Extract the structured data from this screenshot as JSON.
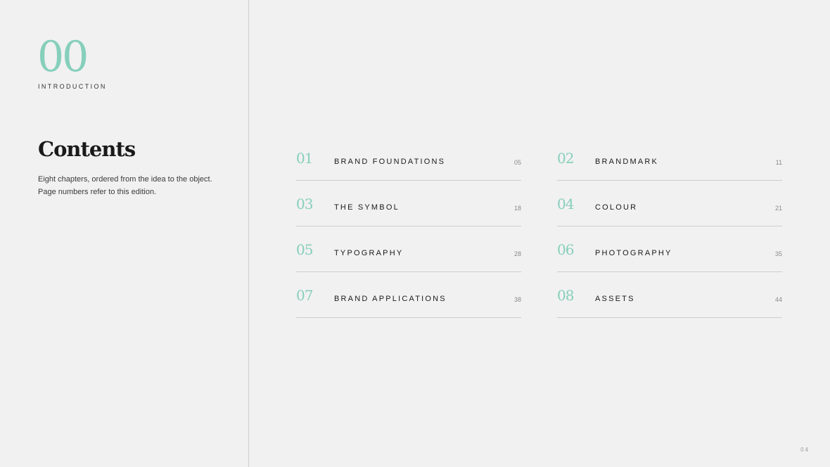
{
  "section": {
    "number": "00",
    "label": "INTRODUCTION"
  },
  "contents": {
    "title": "Contents",
    "description": "Eight chapters, ordered from the idea to the object. Page numbers refer to this edition."
  },
  "toc": [
    {
      "num": "01",
      "title": "BRAND FOUNDATIONS",
      "page": "05"
    },
    {
      "num": "02",
      "title": "BRANDMARK",
      "page": "11"
    },
    {
      "num": "03",
      "title": "THE SYMBOL",
      "page": "18"
    },
    {
      "num": "04",
      "title": "COLOUR",
      "page": "21"
    },
    {
      "num": "05",
      "title": "TYPOGRAPHY",
      "page": "28"
    },
    {
      "num": "06",
      "title": "PHOTOGRAPHY",
      "page": "35"
    },
    {
      "num": "07",
      "title": "BRAND APPLICATIONS",
      "page": "38"
    },
    {
      "num": "08",
      "title": "ASSETS",
      "page": "44"
    }
  ],
  "footer": {
    "page_number": "04"
  },
  "colors": {
    "accent": "#86cfbb",
    "background": "#f1f1f1",
    "divider": "#cdcdcd"
  }
}
